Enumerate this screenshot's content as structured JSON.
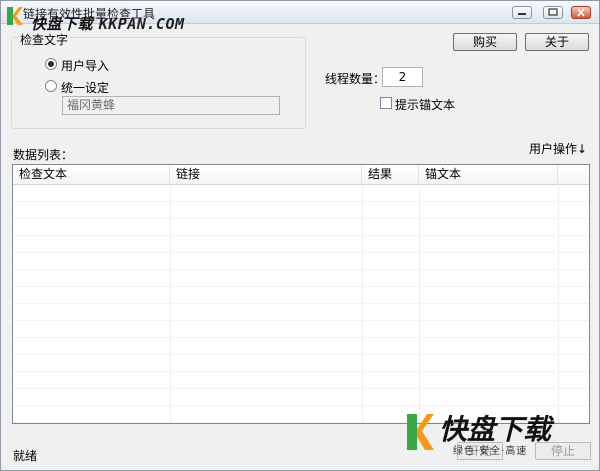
{
  "window": {
    "title": "链接有效性批量检查工具",
    "watermark_cn": "快盘下载",
    "watermark_en": "KKPAN.COM"
  },
  "toolbar": {
    "buy_label": "购买",
    "close_label": "关于"
  },
  "check_group": {
    "legend": "检查文字",
    "options": [
      {
        "label": "用户导入",
        "checked": true
      },
      {
        "label": "统一设定",
        "checked": false
      }
    ],
    "text_value": "福冈黄蜂"
  },
  "threads": {
    "label": "线程数量：",
    "value": "2"
  },
  "anchor_checkbox": {
    "label": "提示锚文本",
    "checked": false
  },
  "data_list": {
    "label": "数据列表：",
    "user_action": "用户操作↓",
    "columns": [
      "检查文本",
      "链接",
      "结果",
      "锚文本"
    ]
  },
  "status": {
    "text": "就绪"
  },
  "bottom_buttons": {
    "start": "开始",
    "stop": "停止"
  },
  "corner_watermark": {
    "cn": "快盘下载",
    "tagline": "绿色·安全·高速"
  },
  "colors": {
    "accent_green": "#3aa64a",
    "logo_orange": "#f39a1e"
  }
}
